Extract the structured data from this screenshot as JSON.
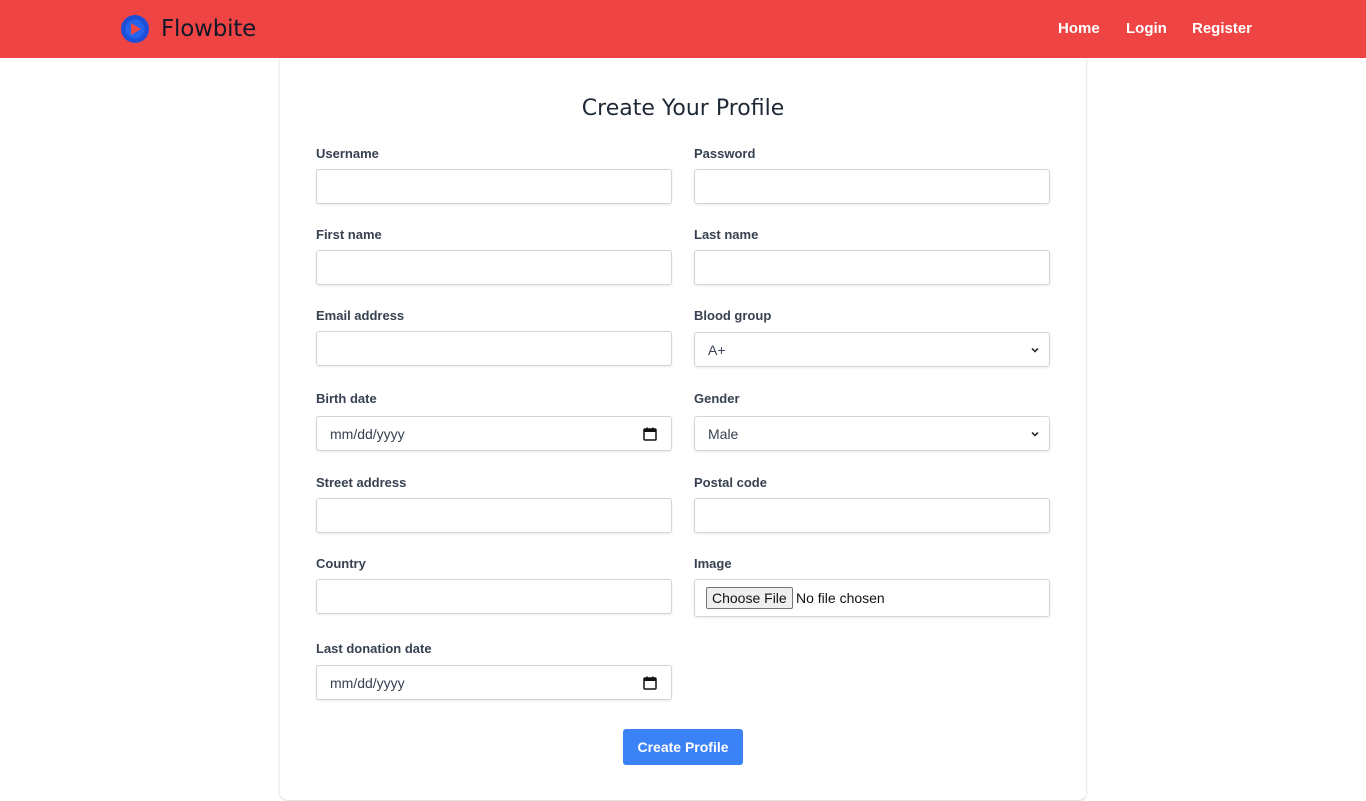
{
  "navbar": {
    "brand": "Flowbite",
    "links": [
      "Home",
      "Login",
      "Register"
    ]
  },
  "form": {
    "title": "Create Your Profile",
    "username_label": "Username",
    "password_label": "Password",
    "first_name_label": "First name",
    "last_name_label": "Last name",
    "email_label": "Email address",
    "blood_group_label": "Blood group",
    "blood_group_value": "A+",
    "birth_date_label": "Birth date",
    "birth_date_placeholder": "mm/dd/yyyy",
    "gender_label": "Gender",
    "gender_value": "Male",
    "street_label": "Street address",
    "postal_label": "Postal code",
    "country_label": "Country",
    "image_label": "Image",
    "file_button": "Choose File",
    "file_status": "No file chosen",
    "last_donation_label": "Last donation date",
    "last_donation_placeholder": "mm/dd/yyyy",
    "submit_label": "Create Profile"
  },
  "colors": {
    "navbar_bg": "#ef4444",
    "submit_bg": "#3b82f6"
  }
}
